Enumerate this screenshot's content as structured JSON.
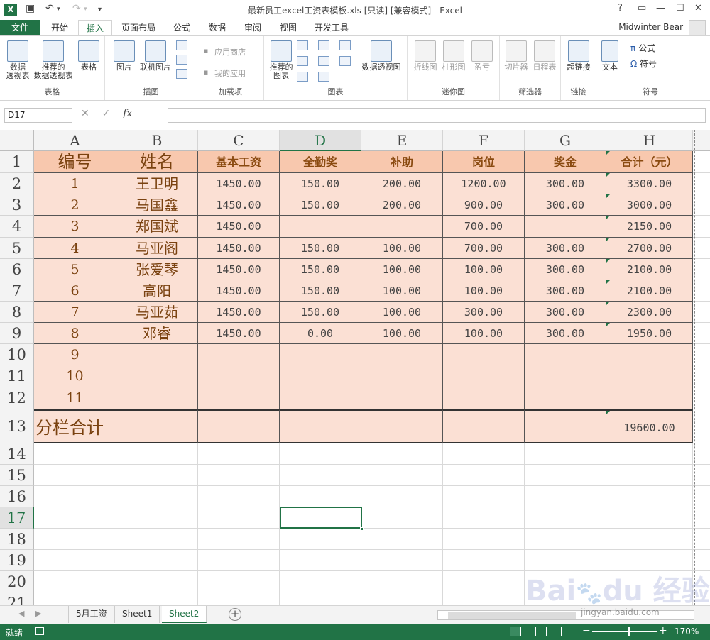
{
  "window": {
    "title": "最新员工excel工资表模板.xls  [只读]  [兼容模式] - Excel",
    "help": "?",
    "user": "Midwinter Bear"
  },
  "ribbon": {
    "file_tab": "文件",
    "tabs": [
      "开始",
      "插入",
      "页面布局",
      "公式",
      "数据",
      "审阅",
      "视图",
      "开发工具"
    ],
    "active_tab": "插入",
    "groups": {
      "tables": {
        "label": "表格",
        "pivot": "数据\n透视表",
        "recommended_pivot": "推荐的\n数据透视表",
        "table": "表格"
      },
      "illustrations": {
        "label": "插图",
        "pictures": "图片",
        "online_pictures": "联机图片"
      },
      "addins": {
        "label": "加载项",
        "store": "应用商店",
        "my_apps": "我的应用"
      },
      "charts": {
        "label": "图表",
        "recommended": "推荐的\n图表",
        "pivot_chart": "数据透视图"
      },
      "sparklines": {
        "label": "迷你图",
        "line": "折线图",
        "column": "柱形图",
        "winloss": "盈亏"
      },
      "filters": {
        "label": "筛选器",
        "slicer": "切片器",
        "timeline": "日程表"
      },
      "links": {
        "label": "链接",
        "hyperlink": "超链接"
      },
      "text": {
        "label": "",
        "text": "文本"
      },
      "symbols": {
        "label": "符号",
        "equation": "公式",
        "symbol": "符号"
      }
    }
  },
  "formula_bar": {
    "name_box": "D17",
    "cancel": "✕",
    "enter": "✓",
    "fx": "fx",
    "formula": ""
  },
  "columns": [
    "A",
    "B",
    "C",
    "D",
    "E",
    "F",
    "G",
    "H"
  ],
  "rows": [
    "1",
    "2",
    "3",
    "4",
    "5",
    "6",
    "7",
    "8",
    "9",
    "10",
    "11",
    "12",
    "13",
    "14",
    "15",
    "16",
    "17",
    "18",
    "19",
    "20",
    "21"
  ],
  "selected_column": "D",
  "selected_row": "17",
  "table": {
    "headers": [
      "编号",
      "姓名",
      "基本工资",
      "全勤奖",
      "补助",
      "岗位",
      "奖金",
      "合计（元）"
    ],
    "rows": [
      [
        "1",
        "王卫明",
        "1450.00",
        "150.00",
        "200.00",
        "1200.00",
        "300.00",
        "3300.00"
      ],
      [
        "2",
        "马国鑫",
        "1450.00",
        "150.00",
        "200.00",
        "900.00",
        "300.00",
        "3000.00"
      ],
      [
        "3",
        "郑国斌",
        "1450.00",
        "",
        "",
        "700.00",
        "",
        "2150.00"
      ],
      [
        "4",
        "马亚阁",
        "1450.00",
        "150.00",
        "100.00",
        "700.00",
        "300.00",
        "2700.00"
      ],
      [
        "5",
        "张爱琴",
        "1450.00",
        "150.00",
        "100.00",
        "100.00",
        "300.00",
        "2100.00"
      ],
      [
        "6",
        "高阳",
        "1450.00",
        "150.00",
        "100.00",
        "100.00",
        "300.00",
        "2100.00"
      ],
      [
        "7",
        "马亚茹",
        "1450.00",
        "150.00",
        "100.00",
        "300.00",
        "300.00",
        "2300.00"
      ],
      [
        "8",
        "邓睿",
        "1450.00",
        "0.00",
        "100.00",
        "100.00",
        "300.00",
        "1950.00"
      ],
      [
        "9",
        "",
        "",
        "",
        "",
        "",
        "",
        ""
      ],
      [
        "10",
        "",
        "",
        "",
        "",
        "",
        "",
        ""
      ],
      [
        "11",
        "",
        "",
        "",
        "",
        "",
        "",
        ""
      ]
    ],
    "subtotal_label": "分栏合计",
    "subtotal_value": "19600.00"
  },
  "sheets": [
    "5月工资",
    "Sheet1",
    "Sheet2"
  ],
  "active_sheet": "Sheet2",
  "status": {
    "ready": "就绪",
    "zoom": "170%",
    "zoom_level_percent": 170
  },
  "watermark": {
    "text": "Bai du 经验",
    "url": "jingyan.baidu.com"
  },
  "colors": {
    "excel_green": "#217346",
    "header_fill": "#f8c8ae",
    "body_fill": "#fbe0d4",
    "text_brown": "#7a4210"
  }
}
